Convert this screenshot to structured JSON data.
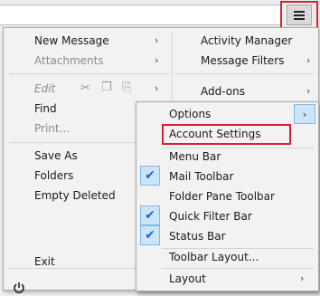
{
  "toolbar": {
    "menu_button_icon": "hamburger-icon"
  },
  "left_column": {
    "new_message": "New Message",
    "attachments": "Attachments",
    "edit": "Edit",
    "find": "Find",
    "print": "Print...",
    "save_as": "Save As",
    "folders": "Folders",
    "empty_deleted": "Empty Deleted",
    "exit": "Exit"
  },
  "right_column": {
    "activity_manager": "Activity Manager",
    "message_filters": "Message Filters",
    "add_ons": "Add-ons"
  },
  "submenu": {
    "options": "Options",
    "account_settings": "Account Settings",
    "menu_bar": "Menu Bar",
    "mail_toolbar": "Mail Toolbar",
    "folder_pane_toolbar": "Folder Pane Toolbar",
    "quick_filter_bar": "Quick Filter Bar",
    "status_bar": "Status Bar",
    "toolbar_layout": "Toolbar Layout...",
    "layout": "Layout",
    "checked": {
      "mail_toolbar": true,
      "quick_filter_bar": true,
      "status_bar": true,
      "menu_bar": false,
      "folder_pane_toolbar": false
    }
  },
  "colors": {
    "highlight_red": "#d6232c",
    "check_blue": "#1769c2",
    "hover_bg": "#cce4f7"
  }
}
